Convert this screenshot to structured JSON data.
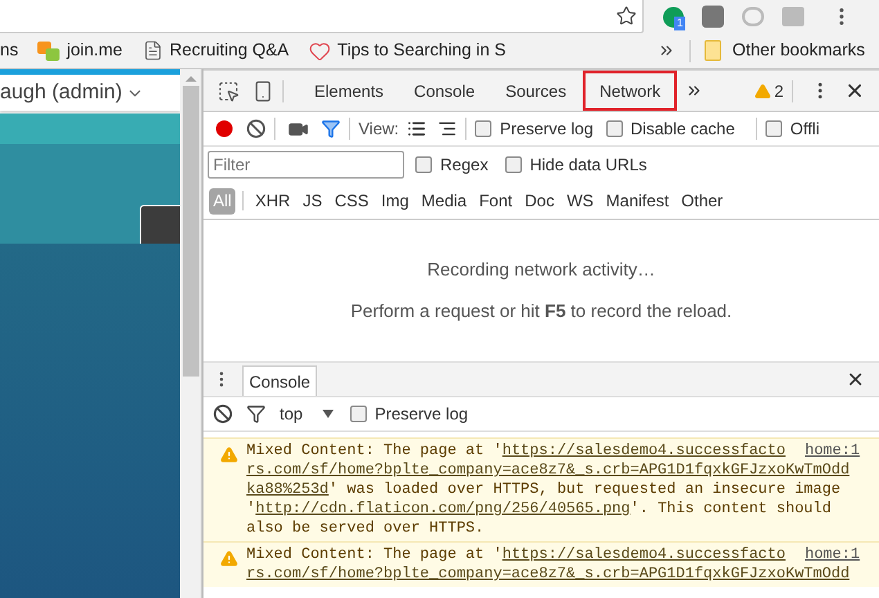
{
  "browser": {
    "extension_badge": "1"
  },
  "bookmarks": [
    {
      "label": "ns",
      "kind": "plain"
    },
    {
      "label": "join.me",
      "kind": "app"
    },
    {
      "label": "Recruiting Q&A",
      "kind": "page"
    },
    {
      "label": "Tips to Searching in S",
      "kind": "heart"
    }
  ],
  "other_bookmarks": "Other bookmarks",
  "page": {
    "user": "augh (admin)"
  },
  "devtools": {
    "tabs": [
      {
        "label": "Elements",
        "selected": false
      },
      {
        "label": "Console",
        "selected": false
      },
      {
        "label": "Sources",
        "selected": false
      },
      {
        "label": "Network",
        "selected": true
      }
    ],
    "warnings": "2",
    "toolbar": {
      "recording": true,
      "filter_active": true,
      "view_label": "View:",
      "checkboxes": [
        {
          "label": "Preserve log",
          "checked": false
        },
        {
          "label": "Disable cache",
          "checked": false
        },
        {
          "label": "Offli",
          "checked": false
        }
      ]
    },
    "filter": {
      "placeholder": "Filter",
      "options": [
        {
          "label": "Regex",
          "checked": false
        },
        {
          "label": "Hide data URLs",
          "checked": false
        }
      ]
    },
    "types": [
      {
        "label": "All",
        "selected": true
      },
      {
        "label": "XHR",
        "selected": false
      },
      {
        "label": "JS",
        "selected": false
      },
      {
        "label": "CSS",
        "selected": false
      },
      {
        "label": "Img",
        "selected": false
      },
      {
        "label": "Media",
        "selected": false
      },
      {
        "label": "Font",
        "selected": false
      },
      {
        "label": "Doc",
        "selected": false
      },
      {
        "label": "WS",
        "selected": false
      },
      {
        "label": "Manifest",
        "selected": false
      },
      {
        "label": "Other",
        "selected": false
      }
    ],
    "empty_state": {
      "line_1": "Recording network activity…",
      "line_2": "Perform a request or hit **F5** to record the reload."
    },
    "drawer": {
      "tabs": [
        {
          "label": "Console",
          "selected": true
        }
      ],
      "context": "top",
      "preserve_log": {
        "label": "Preserve log",
        "checked": false
      },
      "messages": [
        {
          "source": "home:1",
          "parts": [
            {
              "kind": "text",
              "text": "Mixed Content: The page at '"
            },
            {
              "kind": "link",
              "text": "https://salesdemo4.successfacto"
            },
            {
              "kind": "link",
              "text": "rs.com/sf/home?bplte_company=ace8z7&_s.crb=APG1D1fqxkGFJzxoKwTmOdd"
            },
            {
              "kind": "link",
              "text": "ka88%253d"
            },
            {
              "kind": "text",
              "text": "' was loaded over HTTPS, but requested an insecure image '"
            },
            {
              "kind": "link",
              "text": "http://cdn.flaticon.com/png/256/40565.png"
            },
            {
              "kind": "text",
              "text": "'. This content should also be served over HTTPS."
            }
          ]
        },
        {
          "source": "home:1",
          "parts": [
            {
              "kind": "text",
              "text": "Mixed Content: The page at '"
            },
            {
              "kind": "link",
              "text": "https://salesdemo4.successfacto"
            },
            {
              "kind": "link",
              "text": "rs.com/sf/home?bplte_company=ace8z7&_s.crb=APG1D1fqxkGFJzxoKwTmOdd"
            }
          ]
        }
      ]
    }
  }
}
